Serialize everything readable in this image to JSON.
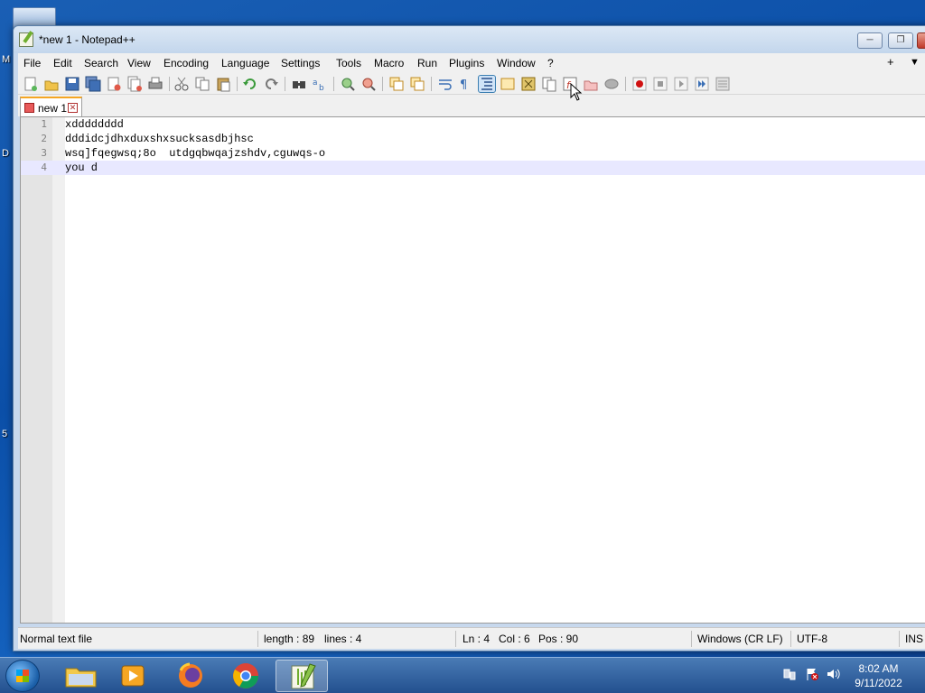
{
  "window": {
    "title": "*new 1 - Notepad++",
    "controls": [
      "minimize",
      "maximize",
      "close"
    ]
  },
  "menu": {
    "items": [
      "File",
      "Edit",
      "Search",
      "View",
      "Encoding",
      "Language",
      "Settings",
      "Tools",
      "Macro",
      "Run",
      "Plugins",
      "Window",
      "?"
    ],
    "right": [
      "+",
      "▼"
    ]
  },
  "toolbar": {
    "icons": [
      "new-file-icon",
      "open-file-icon",
      "save-icon",
      "save-all-icon",
      "close-icon",
      "close-all-icon",
      "print-icon",
      "cut-icon",
      "copy-icon",
      "paste-icon",
      "undo-icon",
      "redo-icon",
      "find-icon",
      "replace-icon",
      "zoom-in-icon",
      "zoom-out-icon",
      "sync-vertical-icon",
      "sync-horizontal-icon",
      "word-wrap-icon",
      "show-all-characters-icon",
      "indent-guide-icon",
      "user-defined-language-icon",
      "document-map-icon",
      "document-list-icon",
      "function-list-icon",
      "folder-as-workspace-icon",
      "monitoring-icon",
      "record-macro-icon",
      "stop-recording-icon",
      "play-macro-icon",
      "run-macro-multiple-icon",
      "save-macro-icon"
    ]
  },
  "tab": {
    "label": "new 1"
  },
  "editor": {
    "lines": [
      {
        "number": "1",
        "text": "xdddddddd"
      },
      {
        "number": "2",
        "text": "dddidcjdhxduxshxsucksasdbjhsc"
      },
      {
        "number": "3",
        "text": "wsq]fqegwsq;8o  utdgqbwqajzshdv,cguwqs-o"
      },
      {
        "number": "4",
        "text": "you d"
      }
    ]
  },
  "status": {
    "file_type": "Normal text file",
    "length": "length : 89",
    "lines": "lines : 4",
    "ln": "Ln : 4",
    "col": "Col : 6",
    "pos": "Pos : 90",
    "eol": "Windows (CR LF)",
    "encoding": "UTF-8",
    "mode": "INS"
  },
  "taskbar": {
    "apps": [
      "file-explorer-icon",
      "media-player-icon",
      "firefox-icon",
      "chrome-icon",
      "notepad-plus-plus-icon"
    ],
    "time": "8:02 AM",
    "date": "9/11/2022"
  },
  "desktop": {
    "edge_letters": [
      "M",
      "D",
      "5"
    ]
  }
}
